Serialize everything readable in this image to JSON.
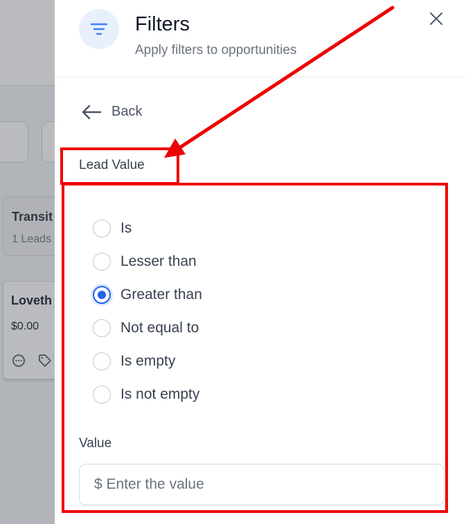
{
  "board": {
    "stage_title": "Transit",
    "stage_count": "1 Leads",
    "lead_name": "Loveth",
    "lead_value": "$0.00",
    "icons": [
      "chat-icon",
      "tag-icon"
    ]
  },
  "panel": {
    "title": "Filters",
    "subtitle": "Apply filters to opportunities",
    "header_icon": "filter-icon",
    "close_icon": "close-icon",
    "back_label": "Back",
    "section_label": "Lead Value",
    "options": [
      {
        "label": "Is",
        "selected": false
      },
      {
        "label": "Lesser than",
        "selected": false
      },
      {
        "label": "Greater than",
        "selected": true
      },
      {
        "label": "Not equal to",
        "selected": false
      },
      {
        "label": "Is empty",
        "selected": false
      },
      {
        "label": "Is not empty",
        "selected": false
      }
    ],
    "value_label": "Value",
    "value_placeholder": "$ Enter the value",
    "value": ""
  },
  "colors": {
    "accent": "#2563eb",
    "annotation": "#ee0000",
    "overlay": "#a9acb1"
  }
}
